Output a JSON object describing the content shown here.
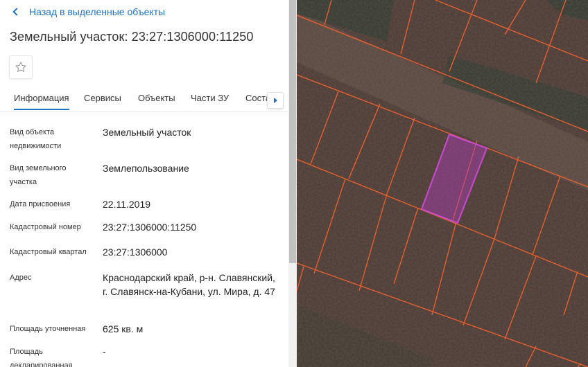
{
  "header": {
    "back_label": "Назад в выделенные объекты",
    "title": "Земельный участок: 23:27:1306000:11250"
  },
  "tabs": [
    {
      "label": "Информация",
      "active": true
    },
    {
      "label": "Сервисы",
      "active": false
    },
    {
      "label": "Объекты",
      "active": false
    },
    {
      "label": "Части ЗУ",
      "active": false
    },
    {
      "label": "Соста",
      "active": false
    }
  ],
  "info": {
    "object_type": {
      "label": "Вид объекта недвижимости",
      "value": "Земельный участок"
    },
    "land_type": {
      "label": "Вид земельного участка",
      "value": "Землепользование"
    },
    "assign_date": {
      "label": "Дата присвоения",
      "value": "22.11.2019"
    },
    "cadastral_number": {
      "label": "Кадастровый номер",
      "value": "23:27:1306000:11250"
    },
    "cadastral_quarter": {
      "label": "Кадастровый квартал",
      "value": "23:27:1306000"
    },
    "address": {
      "label": "Адрес",
      "value": "Краснодарский край, р-н. Славянский, г. Славянск-на-Кубани, ул. Мира, д. 47"
    },
    "area_refined": {
      "label": "Площадь уточненная",
      "value": "625 кв. м"
    },
    "area_declared": {
      "label": "Площадь декларированная",
      "value": "-"
    }
  },
  "colors": {
    "accent": "#1a73c7",
    "parcel_line": "#f0602c",
    "selected_parcel": "#c03cc0"
  }
}
